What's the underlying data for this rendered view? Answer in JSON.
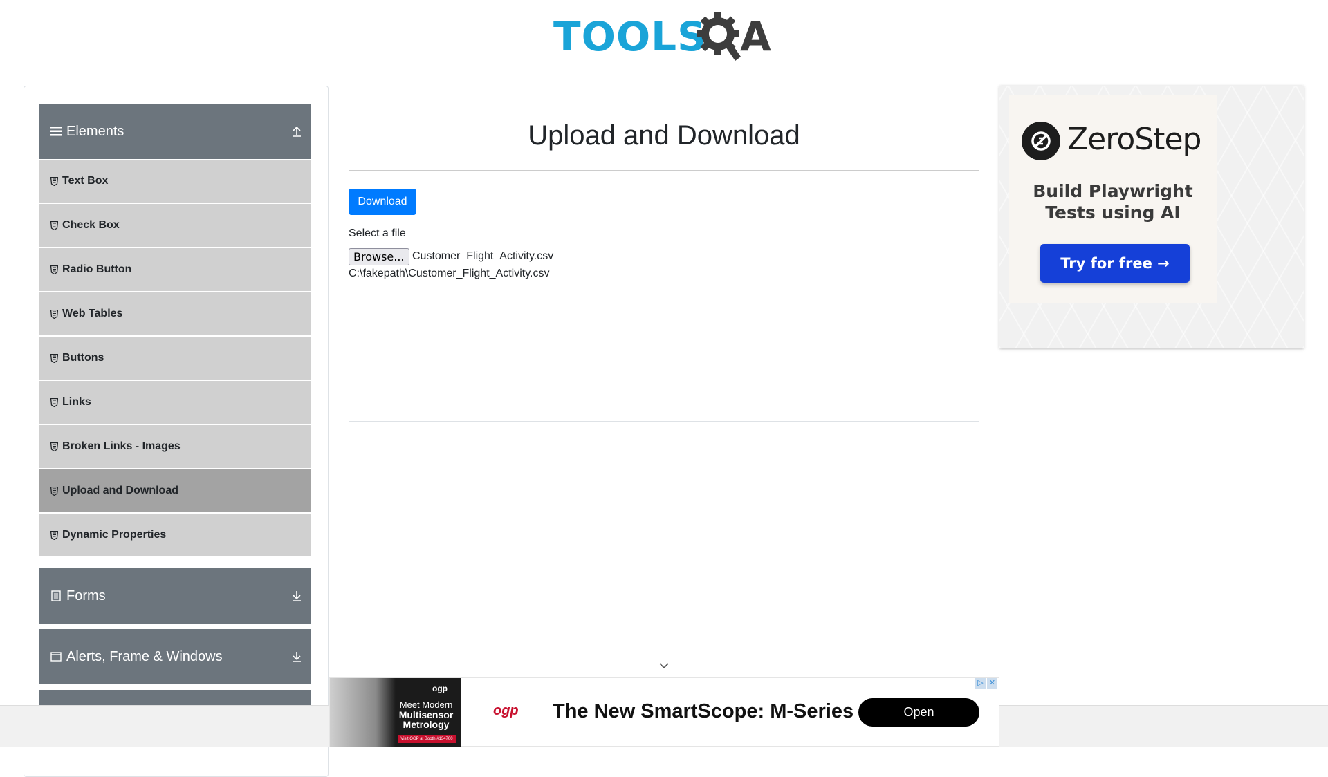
{
  "header": {
    "logo_text": "TOOLS",
    "logo_suffix": "A"
  },
  "sidebar": {
    "elements": {
      "title": "Elements",
      "items": [
        {
          "label": "Text Box"
        },
        {
          "label": "Check Box"
        },
        {
          "label": "Radio Button"
        },
        {
          "label": "Web Tables"
        },
        {
          "label": "Buttons"
        },
        {
          "label": "Links"
        },
        {
          "label": "Broken Links - Images"
        },
        {
          "label": "Upload and Download"
        },
        {
          "label": "Dynamic Properties"
        }
      ],
      "active_item": "Upload and Download"
    },
    "forms": {
      "title": "Forms"
    },
    "alerts": {
      "title": "Alerts, Frame & Windows"
    }
  },
  "main": {
    "title": "Upload and Download",
    "download_label": "Download",
    "select_label": "Select a file",
    "browse_label": "Browse...",
    "file_name": "Customer_Flight_Activity.csv",
    "uploaded_path": "C:\\fakepath\\Customer_Flight_Activity.csv"
  },
  "ad_right": {
    "brand": "ZeroStep",
    "tagline": "Build Playwright Tests using AI",
    "cta": "Try for free →"
  },
  "ad_bottom": {
    "image_logo": "ogp",
    "image_text_1": "Meet Modern",
    "image_text_2": "Multisensor",
    "image_text_3": "Metrology",
    "image_strip": "Visit OGP at Booth #134700",
    "brand": "ogp",
    "headline": "The New SmartScope: M-Series",
    "open_label": "Open"
  },
  "colors": {
    "primary_button": "#007bff",
    "sidebar_header": "#6c757d",
    "menu_item": "#d0d0d0",
    "menu_item_active": "#a3a3a3",
    "logo_blue": "#1aa4d8",
    "zerostep_button": "#1540d8"
  },
  "icons": {
    "elements": "hamburger-icon",
    "collapse": "upload-arrow-icon",
    "expand": "download-arrow-icon",
    "menu_item": "shield-icon",
    "forms": "document-icon",
    "alerts": "window-icon"
  }
}
